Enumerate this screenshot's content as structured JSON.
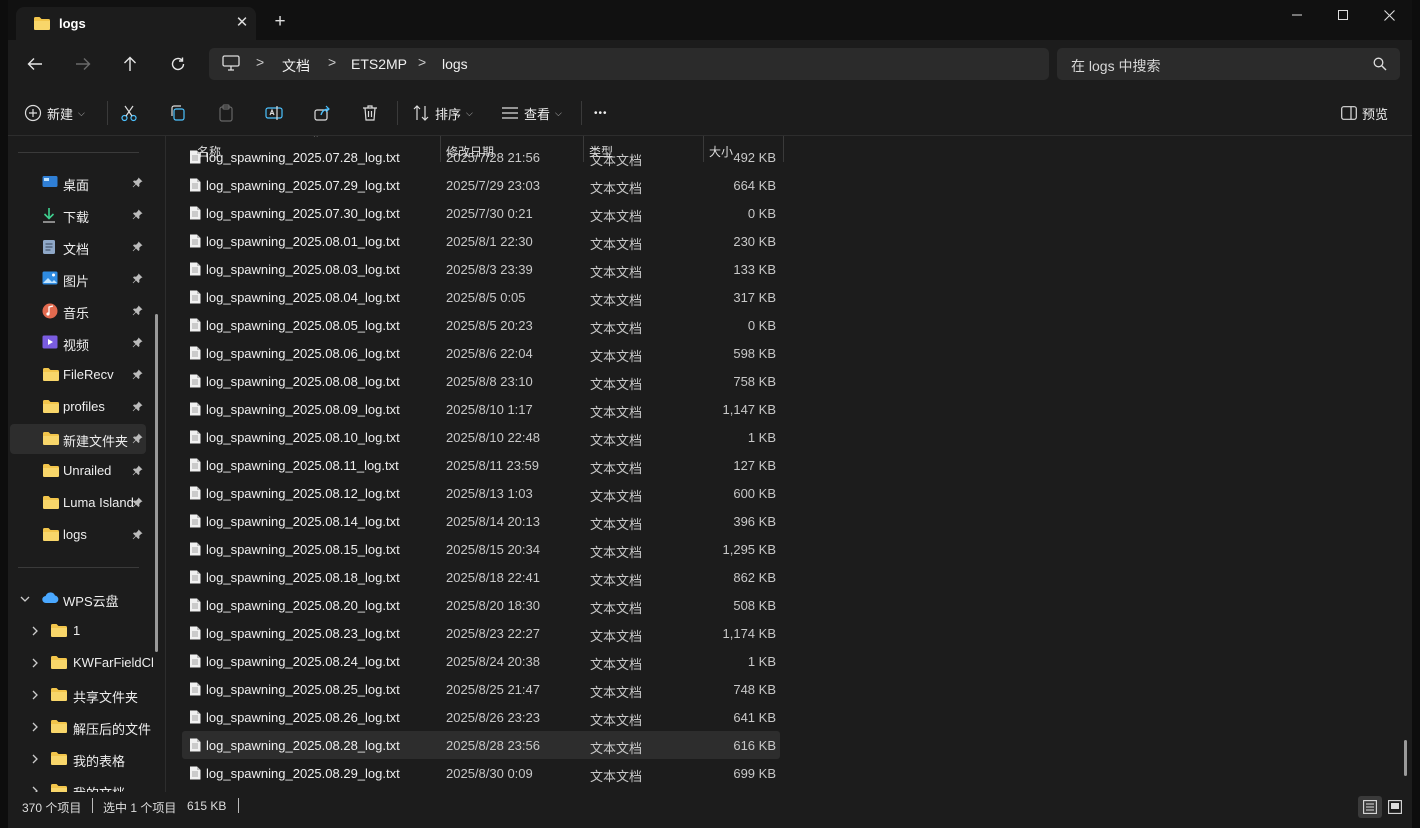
{
  "tab": {
    "title": "logs",
    "close": "✕",
    "new": "+"
  },
  "address": {
    "crumbs": [
      "文档",
      "ETS2MP",
      "logs"
    ],
    "separator": ">"
  },
  "search": {
    "placeholder": "在 logs 中搜索"
  },
  "toolbar": {
    "new_label": "新建",
    "sort_label": "排序",
    "view_label": "查看",
    "more": "•••",
    "preview_label": "预览"
  },
  "sidebar": {
    "quick": [
      {
        "label": "桌面",
        "icon": "desktop-icon"
      },
      {
        "label": "下载",
        "icon": "download-icon"
      },
      {
        "label": "文档",
        "icon": "document-icon"
      },
      {
        "label": "图片",
        "icon": "pictures-icon"
      },
      {
        "label": "音乐",
        "icon": "music-icon"
      },
      {
        "label": "视频",
        "icon": "video-icon"
      },
      {
        "label": "FileRecv",
        "icon": "folder-icon"
      },
      {
        "label": "profiles",
        "icon": "folder-icon"
      },
      {
        "label": "新建文件夹",
        "icon": "folder-icon"
      },
      {
        "label": "Unrailed",
        "icon": "folder-icon"
      },
      {
        "label": "Luma Island",
        "icon": "folder-icon"
      },
      {
        "label": "logs",
        "icon": "folder-icon"
      }
    ],
    "selected_quick": 8,
    "cloud": {
      "label": "WPS云盘"
    },
    "cloud_children": [
      "1",
      "KWFarFieldCl",
      "共享文件夹",
      "解压后的文件",
      "我的表格",
      "我的文档"
    ]
  },
  "columns": {
    "name": "名称",
    "date": "修改日期",
    "type": "类型",
    "size": "大小"
  },
  "files": [
    {
      "name": "log_spawning_2025.07.28_log.txt",
      "date": "2025/7/28 21:56",
      "type": "文本文档",
      "size": "492 KB"
    },
    {
      "name": "log_spawning_2025.07.29_log.txt",
      "date": "2025/7/29 23:03",
      "type": "文本文档",
      "size": "664 KB"
    },
    {
      "name": "log_spawning_2025.07.30_log.txt",
      "date": "2025/7/30 0:21",
      "type": "文本文档",
      "size": "0 KB"
    },
    {
      "name": "log_spawning_2025.08.01_log.txt",
      "date": "2025/8/1 22:30",
      "type": "文本文档",
      "size": "230 KB"
    },
    {
      "name": "log_spawning_2025.08.03_log.txt",
      "date": "2025/8/3 23:39",
      "type": "文本文档",
      "size": "133 KB"
    },
    {
      "name": "log_spawning_2025.08.04_log.txt",
      "date": "2025/8/5 0:05",
      "type": "文本文档",
      "size": "317 KB"
    },
    {
      "name": "log_spawning_2025.08.05_log.txt",
      "date": "2025/8/5 20:23",
      "type": "文本文档",
      "size": "0 KB"
    },
    {
      "name": "log_spawning_2025.08.06_log.txt",
      "date": "2025/8/6 22:04",
      "type": "文本文档",
      "size": "598 KB"
    },
    {
      "name": "log_spawning_2025.08.08_log.txt",
      "date": "2025/8/8 23:10",
      "type": "文本文档",
      "size": "758 KB"
    },
    {
      "name": "log_spawning_2025.08.09_log.txt",
      "date": "2025/8/10 1:17",
      "type": "文本文档",
      "size": "1,147 KB"
    },
    {
      "name": "log_spawning_2025.08.10_log.txt",
      "date": "2025/8/10 22:48",
      "type": "文本文档",
      "size": "1 KB"
    },
    {
      "name": "log_spawning_2025.08.11_log.txt",
      "date": "2025/8/11 23:59",
      "type": "文本文档",
      "size": "127 KB"
    },
    {
      "name": "log_spawning_2025.08.12_log.txt",
      "date": "2025/8/13 1:03",
      "type": "文本文档",
      "size": "600 KB"
    },
    {
      "name": "log_spawning_2025.08.14_log.txt",
      "date": "2025/8/14 20:13",
      "type": "文本文档",
      "size": "396 KB"
    },
    {
      "name": "log_spawning_2025.08.15_log.txt",
      "date": "2025/8/15 20:34",
      "type": "文本文档",
      "size": "1,295 KB"
    },
    {
      "name": "log_spawning_2025.08.18_log.txt",
      "date": "2025/8/18 22:41",
      "type": "文本文档",
      "size": "862 KB"
    },
    {
      "name": "log_spawning_2025.08.20_log.txt",
      "date": "2025/8/20 18:30",
      "type": "文本文档",
      "size": "508 KB"
    },
    {
      "name": "log_spawning_2025.08.23_log.txt",
      "date": "2025/8/23 22:27",
      "type": "文本文档",
      "size": "1,174 KB"
    },
    {
      "name": "log_spawning_2025.08.24_log.txt",
      "date": "2025/8/24 20:38",
      "type": "文本文档",
      "size": "1 KB"
    },
    {
      "name": "log_spawning_2025.08.25_log.txt",
      "date": "2025/8/25 21:47",
      "type": "文本文档",
      "size": "748 KB"
    },
    {
      "name": "log_spawning_2025.08.26_log.txt",
      "date": "2025/8/26 23:23",
      "type": "文本文档",
      "size": "641 KB"
    },
    {
      "name": "log_spawning_2025.08.28_log.txt",
      "date": "2025/8/28 23:56",
      "type": "文本文档",
      "size": "616 KB"
    },
    {
      "name": "log_spawning_2025.08.29_log.txt",
      "date": "2025/8/30 0:09",
      "type": "文本文档",
      "size": "699 KB"
    }
  ],
  "selected_file": 21,
  "status": {
    "count": "370 个项目",
    "selected": "选中 1 个项目",
    "size": "615 KB"
  },
  "colors": {
    "folder": "#f2c54b",
    "accent": "#4cc2ff",
    "bg": "#1c1c1c",
    "titlebar": "#111111"
  }
}
